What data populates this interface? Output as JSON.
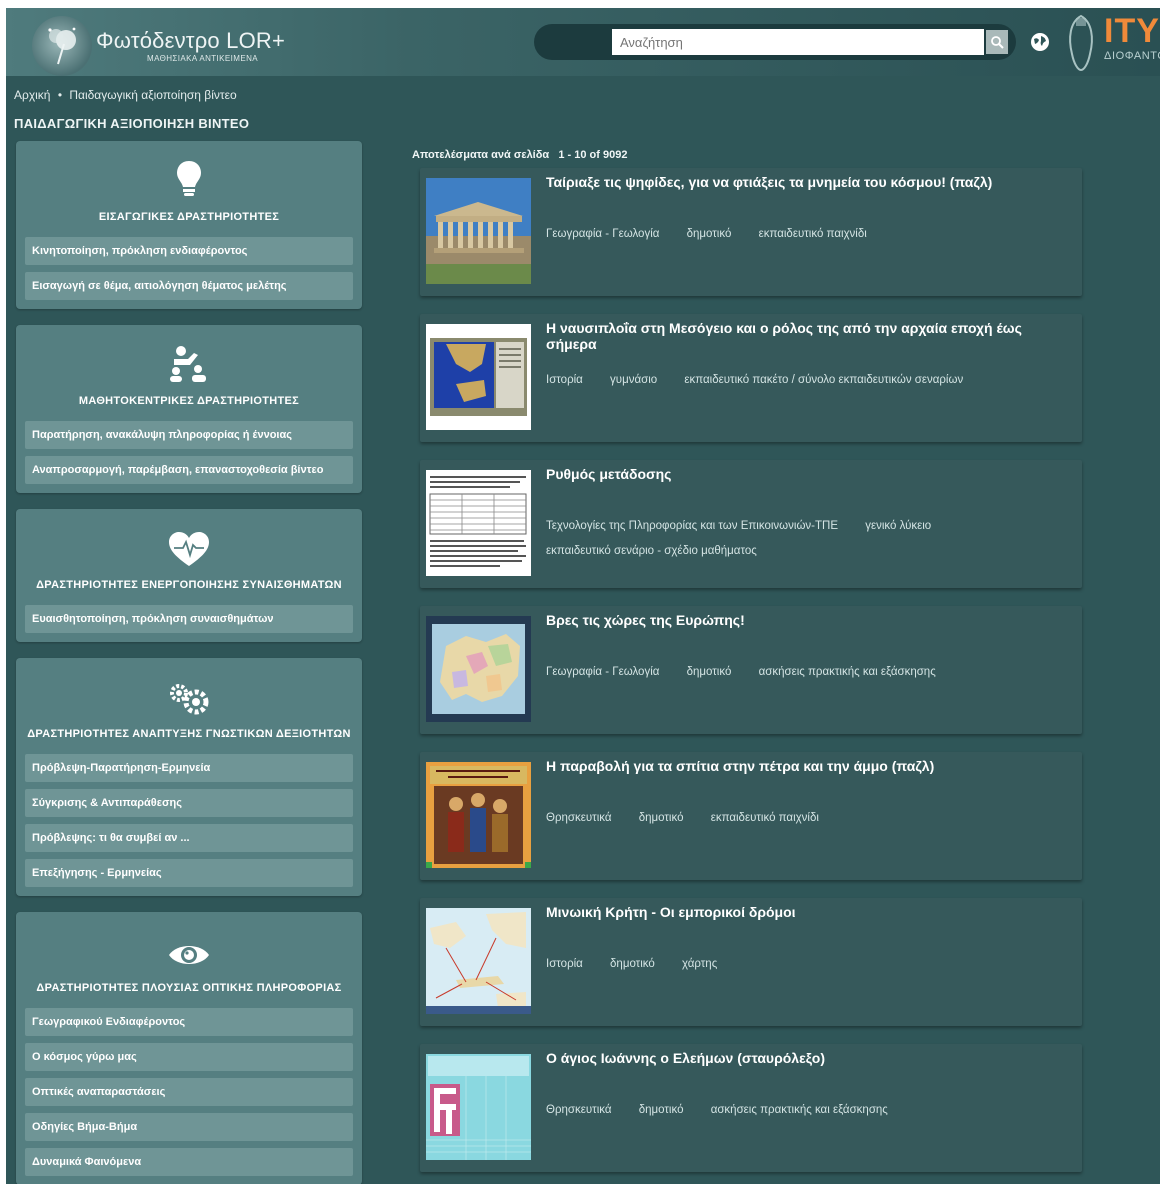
{
  "header": {
    "logo_title": "Φωτόδεντρο LOR+",
    "logo_subtitle": "ΜΑΘΗΣΙΑΚΑ ΑΝΤΙΚΕΙΜΕΝΑ",
    "search_placeholder": "Αναζήτηση",
    "brand_text": "ΙΤΥΕ",
    "brand_subtitle": "ΔΙΟΦΑΝΤΟΣ"
  },
  "breadcrumb": {
    "home": "Αρχική",
    "separator": "•",
    "current": "Παιδαγωγική αξιοποίηση βίντεο"
  },
  "page_title": "ΠΑΙΔΑΓΩΓΙΚΗ ΑΞΙΟΠΟΙΗΣΗ ΒΙΝΤΕΟ",
  "sidebar": [
    {
      "icon": "lightbulb-icon",
      "title": "ΕΙΣΑΓΩΓΙΚΕΣ ΔΡΑΣΤΗΡΙΟΤΗΤΕΣ",
      "items": [
        "Κινητοποίηση, πρόκληση ενδιαφέροντος",
        "Εισαγωγή σε θέμα, αιτιολόγηση θέματος μελέτης"
      ]
    },
    {
      "icon": "learners-icon",
      "title": "ΜΑΘΗΤΟΚΕΝΤΡΙΚΕΣ ΔΡΑΣΤΗΡΙΟΤΗΤΕΣ",
      "items": [
        "Παρατήρηση, ανακάλυψη πληροφορίας ή έννοιας",
        "Αναπροσαρμογή, παρέμβαση, επαναστοχοθεσία βίντεο"
      ]
    },
    {
      "icon": "heartbeat-icon",
      "title": "ΔΡΑΣΤΗΡΙΟΤΗΤΕΣ ΕΝΕΡΓΟΠΟΙΗΣΗΣ ΣΥΝΑΙΣΘΗΜΑΤΩΝ",
      "items": [
        "Ευαισθητοποίηση, πρόκληση συναισθημάτων"
      ]
    },
    {
      "icon": "gears-icon",
      "title": "ΔΡΑΣΤΗΡΙΟΤΗΤΕΣ ΑΝΑΠΤΥΞΗΣ ΓΝΩΣΤΙΚΩΝ ΔΕΞΙΟΤΗΤΩΝ",
      "items": [
        "Πρόβλεψη-Παρατήρηση-Ερμηνεία",
        "Σύγκρισης & Αντιπαράθεσης",
        "Πρόβλεψης: τι θα συμβεί αν ...",
        "Επεξήγησης - Ερμηνείας"
      ]
    },
    {
      "icon": "eye-icon",
      "title": "ΔΡΑΣΤΗΡΙΟΤΗΤΕΣ ΠΛΟΥΣΙΑΣ ΟΠΤΙΚΗΣ ΠΛΗΡΟΦΟΡΙΑΣ",
      "items": [
        "Γεωγραφικού Ενδιαφέροντος",
        "Ο κόσμος γύρω μας",
        "Οπτικές αναπαραστάσεις",
        "Οδηγίες Βήμα-Βήμα",
        "Δυναμικά Φαινόμενα"
      ]
    }
  ],
  "results": {
    "label": "Αποτελέσματα ανά σελίδα",
    "range": "1 - 10 of 9092",
    "items": [
      {
        "thumb": "parthenon",
        "title": "Ταίριαξε τις ψηφίδες, για να φτιάξεις τα μνημεία του κόσμου! (παζλ)",
        "tags": [
          "Γεωγραφία - Γεωλογία",
          "δημοτικό",
          "εκπαιδευτικό παιχνίδι"
        ]
      },
      {
        "thumb": "sea-map",
        "title": "Η ναυσιπλοΐα στη Μεσόγειο και ο ρόλος της από την αρχαία εποχή έως σήμερα",
        "tags": [
          "Ιστορία",
          "γυμνάσιο",
          "εκπαιδευτικό πακέτο / σύνολο εκπαιδευτικών σεναρίων"
        ]
      },
      {
        "thumb": "document",
        "title": "Ρυθμός μετάδοσης",
        "tags": [
          "Τεχνολογίες της Πληροφορίας και των Επικοινωνιών-ΤΠΕ",
          "γενικό λύκειο",
          "εκπαιδευτικό σενάριο - σχέδιο μαθήματος"
        ]
      },
      {
        "thumb": "europe-map",
        "title": "Βρες τις χώρες της Ευρώπης!",
        "tags": [
          "Γεωγραφία - Γεωλογία",
          "δημοτικό",
          "ασκήσεις πρακτικής και εξάσκησης"
        ]
      },
      {
        "thumb": "icon-painting",
        "title": "Η παραβολή για τα σπίτια στην πέτρα και την άμμο (παζλ)",
        "tags": [
          "Θρησκευτικά",
          "δημοτικό",
          "εκπαιδευτικό παιχνίδι"
        ]
      },
      {
        "thumb": "crete-map",
        "title": "Μινωική Κρήτη - Οι εμπορικοί δρόμοι",
        "tags": [
          "Ιστορία",
          "δημοτικό",
          "χάρτης"
        ]
      },
      {
        "thumb": "crossword",
        "title": "Ο άγιος Ιωάννης ο Ελεήμων (σταυρόλεξο)",
        "tags": [
          "Θρησκευτικά",
          "δημοτικό",
          "ασκήσεις πρακτικής και εξάσκησης"
        ]
      }
    ]
  }
}
